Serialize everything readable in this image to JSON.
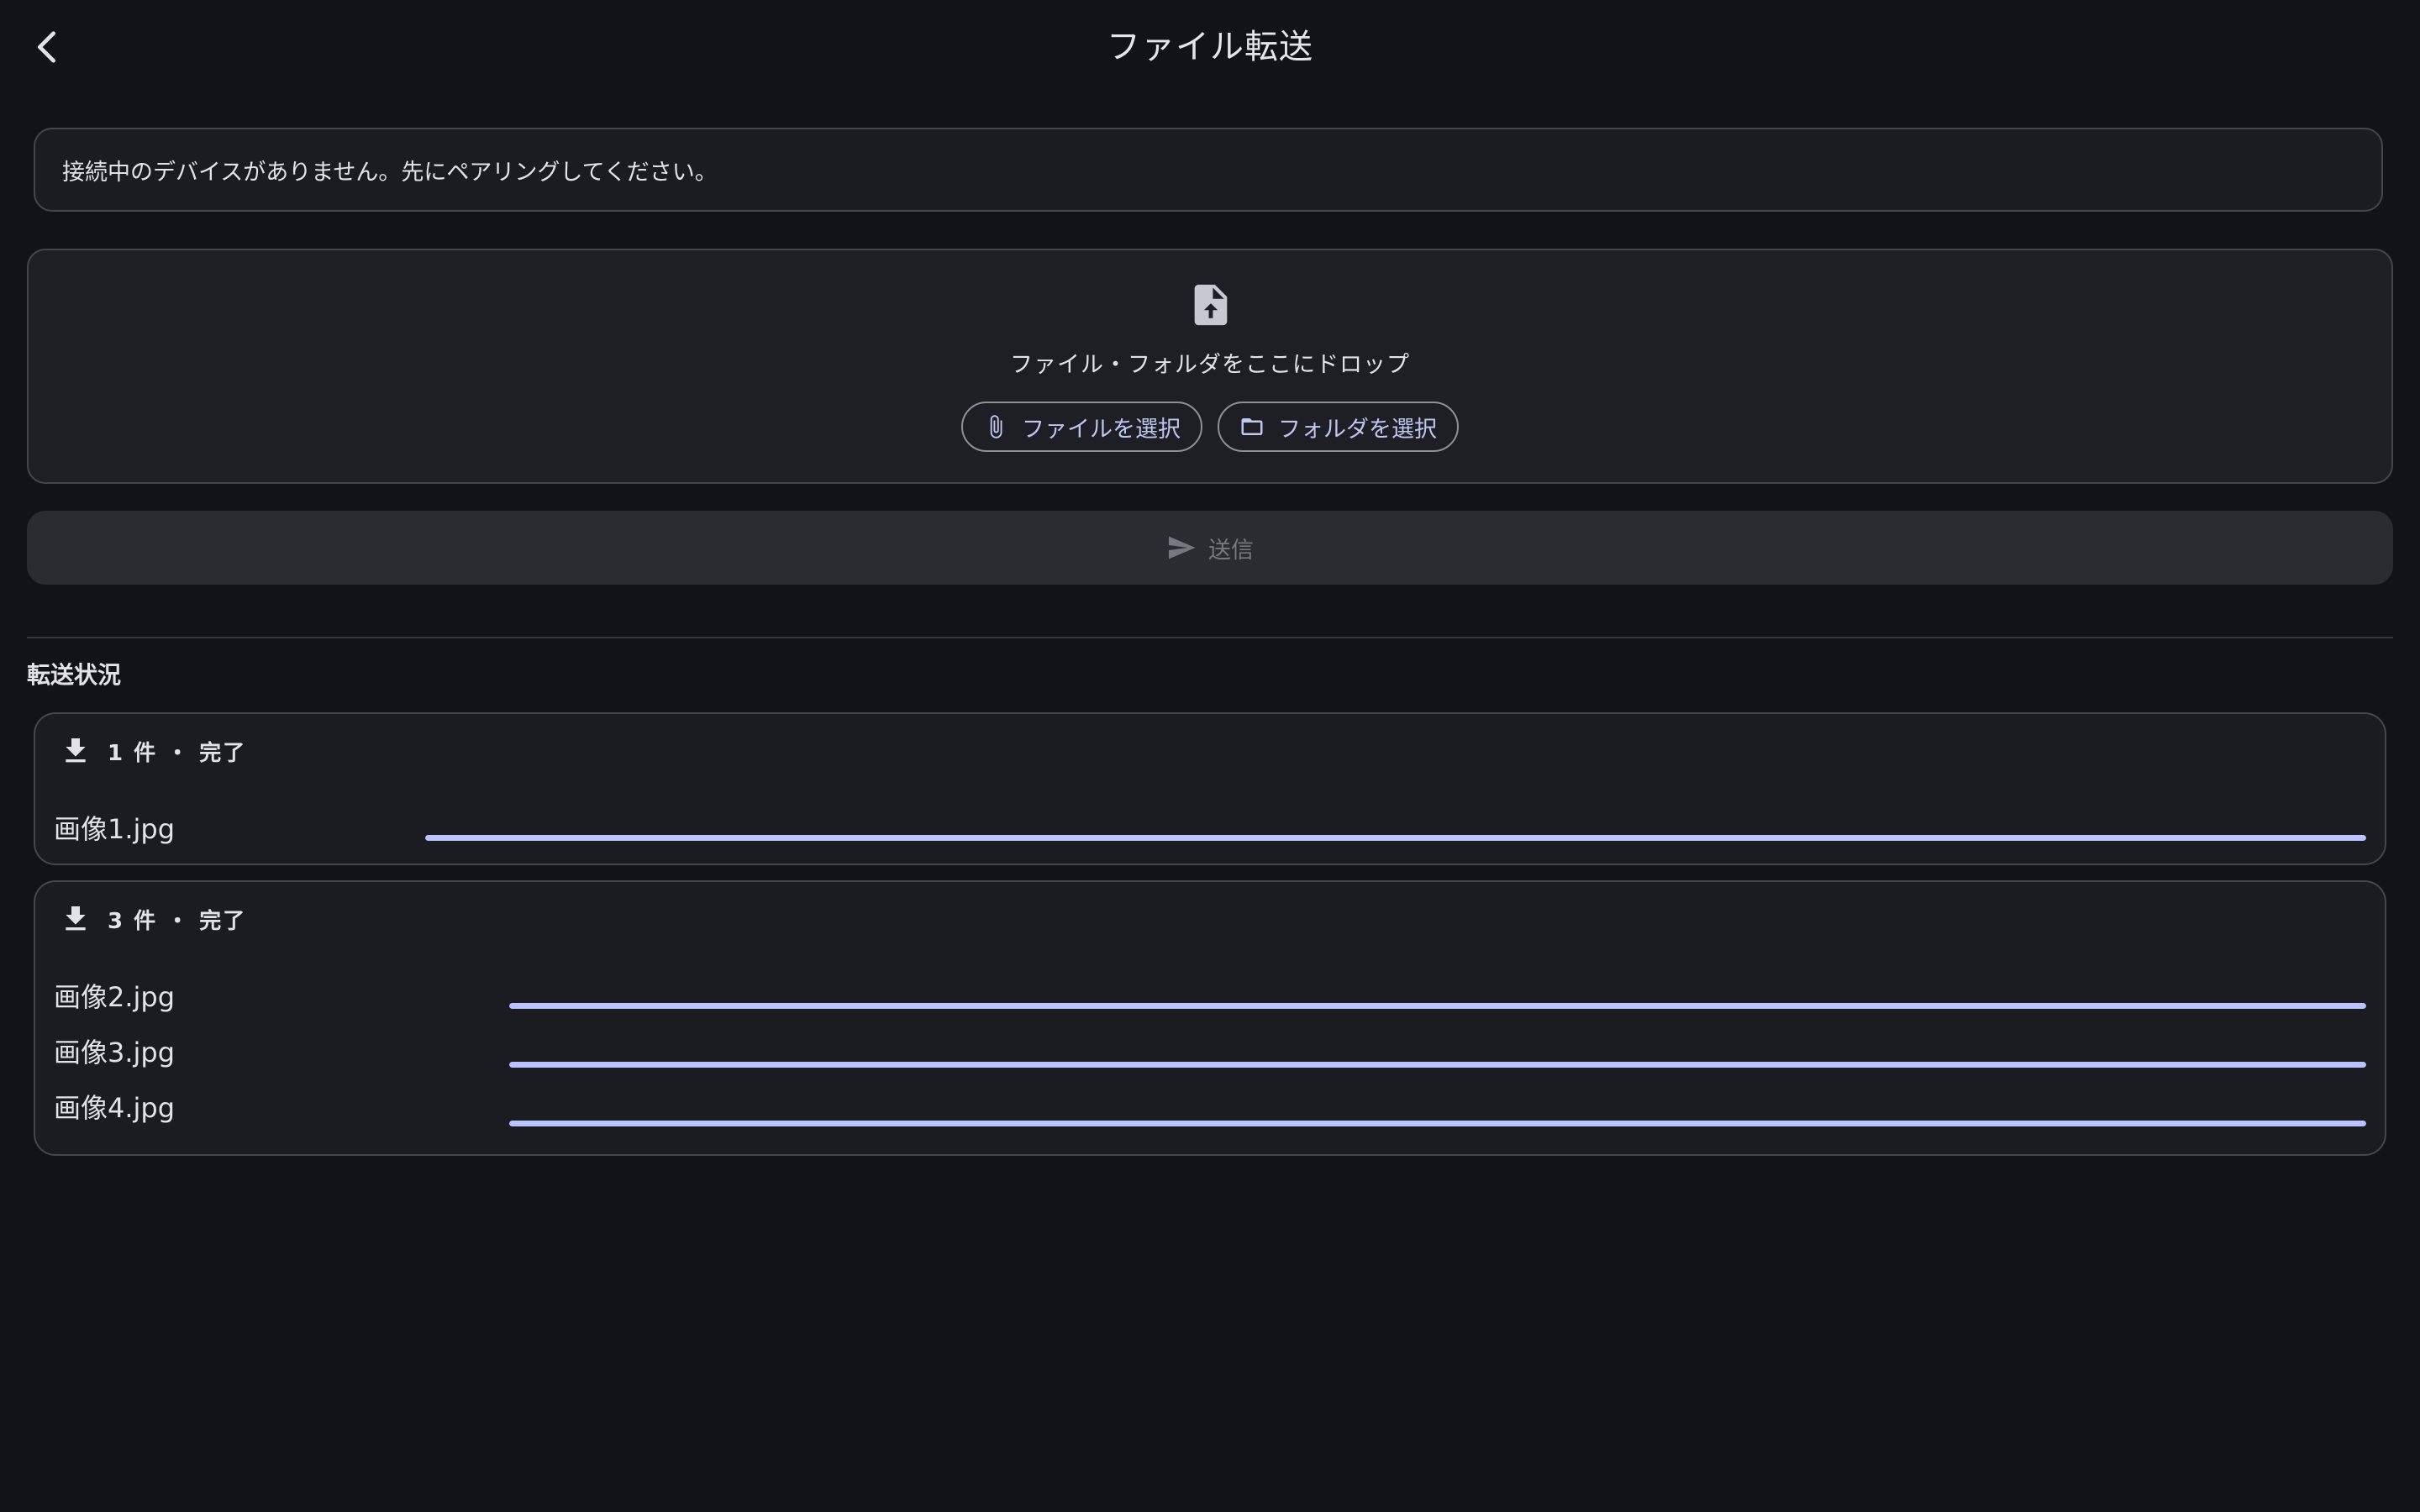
{
  "header": {
    "title": "ファイル転送"
  },
  "notice": {
    "text": "接続中のデバイスがありません。先にペアリングしてください。"
  },
  "dropzone": {
    "hint": "ファイル・フォルダをここにドロップ",
    "select_file_label": "ファイルを選択",
    "select_folder_label": "フォルダを選択"
  },
  "send": {
    "label": "送信",
    "disabled": true
  },
  "transfers": {
    "section_title": "転送状況",
    "groups": [
      {
        "summary": "1 件 ・ 完了",
        "direction_icon": "download-icon",
        "files": [
          {
            "name": "画像1.jpg",
            "progress": 1.0
          }
        ]
      },
      {
        "summary": "3 件 ・ 完了",
        "direction_icon": "download-icon",
        "files": [
          {
            "name": "画像2.jpg",
            "progress": 1.0
          },
          {
            "name": "画像3.jpg",
            "progress": 1.0
          },
          {
            "name": "画像4.jpg",
            "progress": 1.0
          }
        ]
      }
    ]
  },
  "colors": {
    "background": "#111318",
    "surface": "#1b1c21",
    "outline": "#44464f",
    "accent": "#bac3ff",
    "disabled_text": "#77787f"
  }
}
